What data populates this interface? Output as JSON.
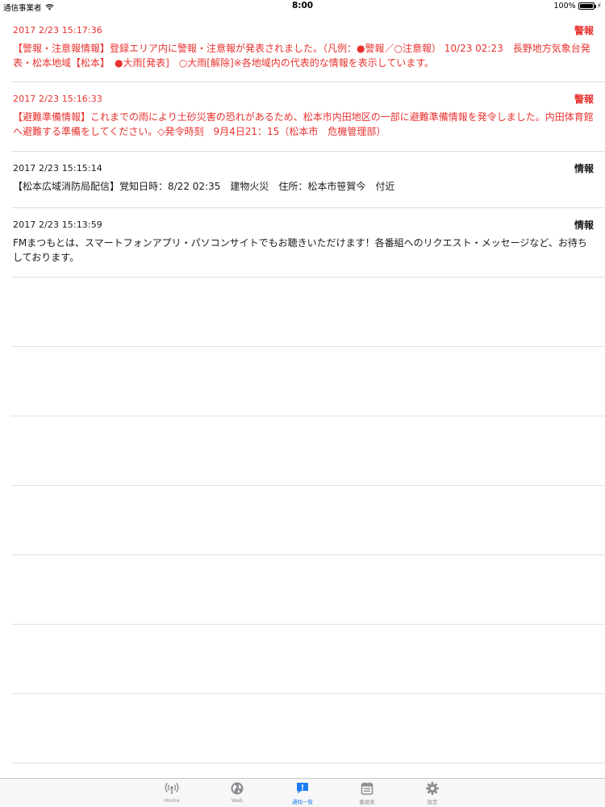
{
  "statusbar": {
    "carrier": "通信事業者",
    "time": "8:00",
    "battery": "100%",
    "battery_level": 1.0
  },
  "notifications": [
    {
      "timestamp": "2017 2/23 15:17:36",
      "kind": "警報",
      "level": "warning",
      "text": "【警報・注意報情報】登録エリア内に警報・注意報が発表されました。（凡例：●警報／○注意報） 10/23 02:23　長野地方気象台発表・松本地域【松本】　●大雨[発表]　○大雨[解除]※各地域内の代表的な情報を表示しています。"
    },
    {
      "timestamp": "2017 2/23 15:16:33",
      "kind": "警報",
      "level": "warning",
      "text": "【避難準備情報】これまでの雨により土砂災害の恐れがあるため、松本市内田地区の一部に避難準備情報を発令しました。内田体育館へ避難する準備をしてください。◇発令時刻　9月4日21：15（松本市　危機管理部）"
    },
    {
      "timestamp": "2017 2/23 15:15:14",
      "kind": "情報",
      "level": "info",
      "text": "【松本広域消防局配信】覚知日時：8/22 02:35　建物火災　住所：松本市笹賀今　付近"
    },
    {
      "timestamp": "2017 2/23 15:13:59",
      "kind": "情報",
      "level": "info",
      "text": "FMまつもとは、スマートフォンアプリ・パソコンサイトでもお聴きいただけます！各番組へのリクエスト・メッセージなど、お待ちしております。"
    }
  ],
  "tabbar": {
    "items": [
      {
        "label": "Home",
        "icon": "broadcast-icon",
        "active": false
      },
      {
        "label": "Web",
        "icon": "globe-icon",
        "active": false
      },
      {
        "label": "通知一覧",
        "icon": "alert-icon",
        "active": true
      },
      {
        "label": "番組表",
        "icon": "calendar-icon",
        "active": false
      },
      {
        "label": "設定",
        "icon": "gear-icon",
        "active": false
      }
    ]
  },
  "colors": {
    "warning": "#e8322f",
    "info": "#1a1a1a",
    "active_tab": "#1e7cf2",
    "inactive_tab": "#8e8e93"
  }
}
